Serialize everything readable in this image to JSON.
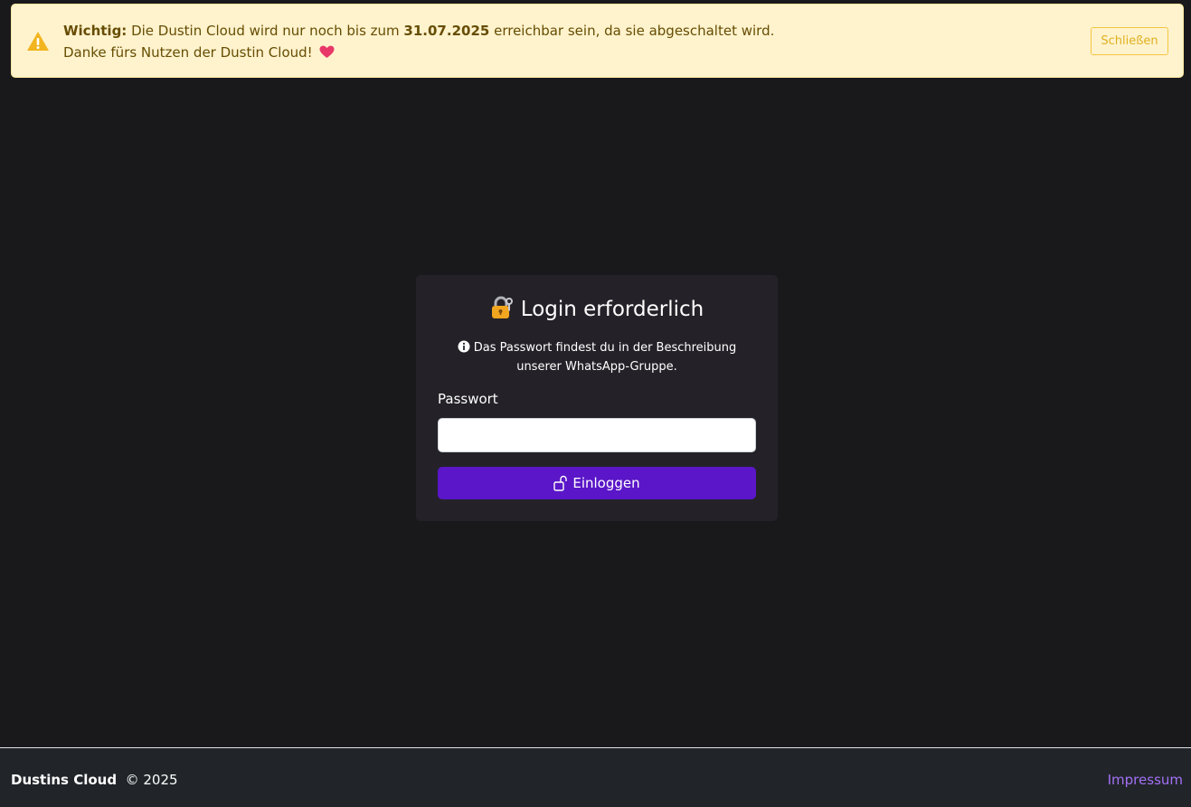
{
  "alert": {
    "icon": "warning-triangle-icon",
    "label": "Wichtig:",
    "text_before": " Die Dustin Cloud wird nur noch bis zum ",
    "date": "31.07.2025",
    "text_after": " erreichbar sein, da sie abgeschaltet wird.",
    "line2": "Danke fürs Nutzen der Dustin Cloud!",
    "heart_icon": "heart-icon",
    "close_label": "Schließen",
    "color_bg": "#fff3cd",
    "color_text": "#664d03"
  },
  "login": {
    "title": "Login erforderlich",
    "title_icon": "lock-key-emoji-icon",
    "info_icon": "info-circle-icon",
    "info_text": "Das Passwort findest du in der Beschreibung unserer WhatsApp-Gruppe.",
    "password_label": "Passwort",
    "password_value": "",
    "password_placeholder": "",
    "button_icon": "unlock-icon",
    "button_label": "Einloggen",
    "accent_color": "#5a16c8"
  },
  "footer": {
    "brand": "Dustins Cloud",
    "copyright": "© 2025",
    "impressum": "Impressum",
    "link_color": "#a370f7"
  }
}
